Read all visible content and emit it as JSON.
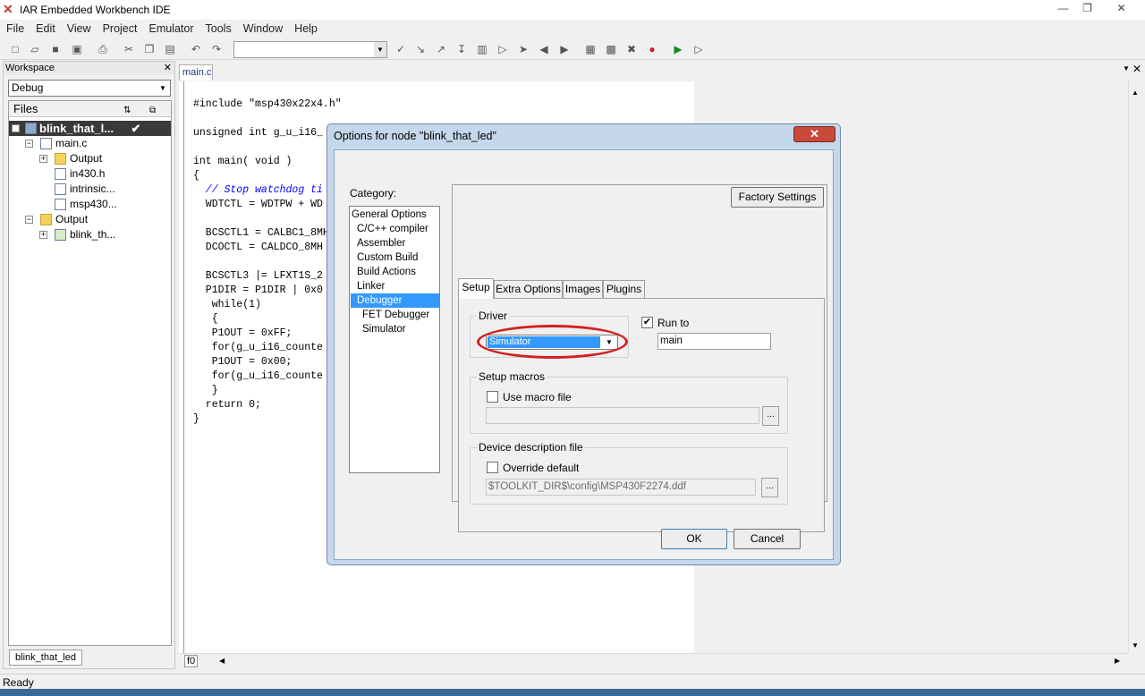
{
  "window": {
    "title": "IAR Embedded Workbench IDE",
    "minimize": "—",
    "maximize": "❐",
    "close": "✕"
  },
  "menu": [
    "File",
    "Edit",
    "View",
    "Project",
    "Emulator",
    "Tools",
    "Window",
    "Help"
  ],
  "workspace": {
    "title": "Workspace",
    "config": "Debug",
    "files_header": "Files",
    "project": "blink_that_l...",
    "tree": [
      "main.c",
      "Output",
      "in430.h",
      "intrinsic...",
      "msp430...",
      "Output",
      "blink_th..."
    ],
    "tab": "blink_that_led"
  },
  "editor": {
    "tab": "main.c",
    "lines": [
      "#include \"msp430x22x4.h\"",
      "",
      "unsigned int g_u_i16_",
      "",
      "int main( void )",
      "{",
      "  // Stop watchdog ti",
      "  WDTCTL = WDTPW + WD",
      "",
      "  BCSCTL1 = CALBC1_8MH",
      "  DCOCTL = CALDCO_8MH",
      "",
      "  BCSCTL3 |= LFXT1S_2",
      "  P1DIR = P1DIR | 0x0",
      "   while(1)",
      "   {",
      "   P1OUT = 0xFF;",
      "   for(g_u_i16_counte",
      "   P1OUT = 0x00;",
      "   for(g_u_i16_counte",
      "   }",
      "  return 0;",
      "}"
    ],
    "bottom_tab": "f0"
  },
  "status": "Ready",
  "dialog": {
    "title": "Options for node \"blink_that_led\"",
    "close": "✕",
    "category_label": "Category:",
    "categories": [
      "General Options",
      "C/C++ compiler",
      "Assembler",
      "Custom Build",
      "Build Actions",
      "Linker",
      "Debugger",
      "FET Debugger",
      "Simulator"
    ],
    "selected_category": "Debugger",
    "factory_settings": "Factory Settings",
    "tabs": [
      "Setup",
      "Extra Options",
      "Images",
      "Plugins"
    ],
    "active_tab": "Setup",
    "driver_label": "Driver",
    "driver_value": "Simulator",
    "run_to_label": "Run to",
    "run_to_checked": true,
    "run_to_value": "main",
    "setup_macros_label": "Setup macros",
    "use_macro_label": "Use macro file",
    "browse": "...",
    "ddf_label": "Device description file",
    "override_label": "Override default",
    "ddf_path": "$TOOLKIT_DIR$\\config\\MSP430F2274.ddf",
    "ok": "OK",
    "cancel": "Cancel",
    "highlight_color": "#d42020"
  }
}
